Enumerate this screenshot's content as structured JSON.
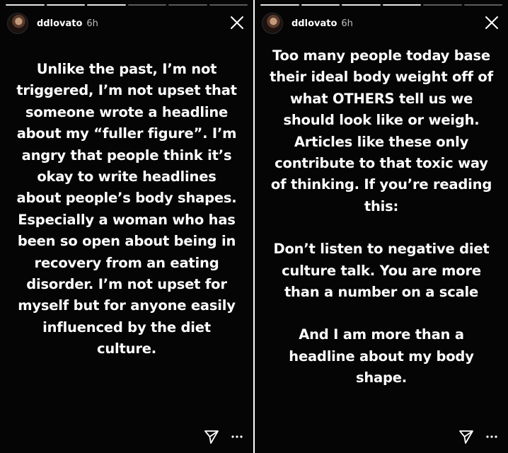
{
  "stories": [
    {
      "username": "ddlovato",
      "time": "6h",
      "progress_total": 6,
      "progress_done": 3,
      "paragraphs": [
        "Unlike the past, I’m not triggered, I’m not upset that someone wrote a headline about my “fuller figure”. I’m angry that people think it’s okay to write headlines about people’s body shapes. Especially a woman who has been so open about being in recovery from an eating disorder. I’m not upset for myself but for anyone easily influenced by the diet culture."
      ],
      "icons": {
        "close": "close-icon",
        "share": "send-icon",
        "more": "more-icon"
      }
    },
    {
      "username": "ddlovato",
      "time": "6h",
      "progress_total": 6,
      "progress_done": 4,
      "paragraphs": [
        "Too many people today base their ideal body weight off of what OTHERS tell us we should look like or weigh. Articles like these only contribute to that toxic way of thinking. If you’re reading this:",
        "Don’t listen to negative diet culture talk. You are more than a number on a scale",
        "And I am more than a headline about my body shape."
      ],
      "icons": {
        "close": "close-icon",
        "share": "send-icon",
        "more": "more-icon"
      }
    }
  ],
  "colors": {
    "background": "#050505",
    "text": "#ffffff",
    "timestamp": "#bdbdbd",
    "divider": "#ffffff"
  }
}
